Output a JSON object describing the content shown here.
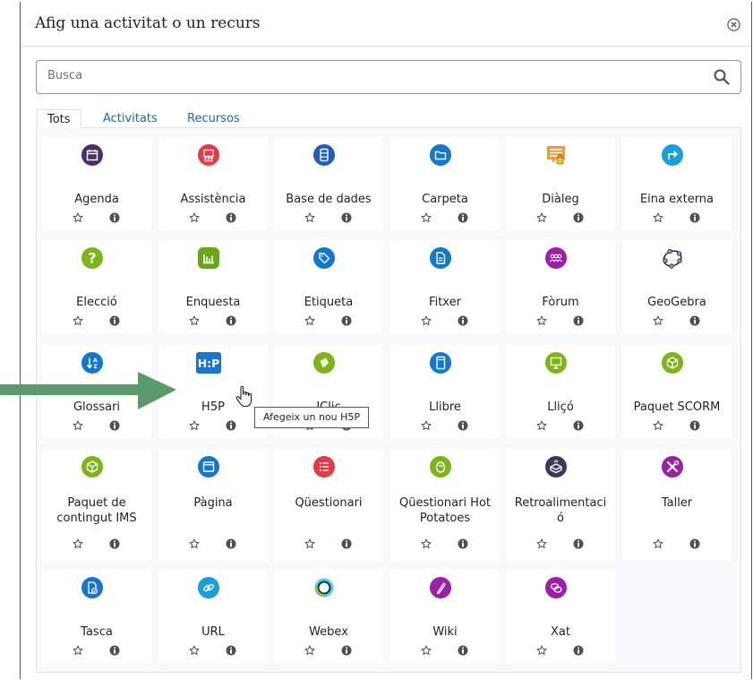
{
  "dialog": {
    "title": "Afig una activitat o un recurs",
    "search_placeholder": "Busca",
    "tabs": [
      {
        "label": "Tots"
      },
      {
        "label": "Activitats"
      },
      {
        "label": "Recursos"
      }
    ]
  },
  "modules": [
    {
      "label": "Agenda",
      "icon": "calendar-icon",
      "color": "#4b2e6f"
    },
    {
      "label": "Assistència",
      "icon": "attendance-icon",
      "color": "#e63946"
    },
    {
      "label": "Base de dades",
      "icon": "database-icon",
      "color": "#1f5fbf"
    },
    {
      "label": "Carpeta",
      "icon": "folder-icon",
      "color": "#1177d1"
    },
    {
      "label": "Diàleg",
      "icon": "dialogue-icon",
      "color": "#f09a3e"
    },
    {
      "label": "Eina externa",
      "icon": "external-tool-icon",
      "color": "#1a9ed9"
    },
    {
      "label": "Elecció",
      "icon": "choice-icon",
      "color": "#7cb518"
    },
    {
      "label": "Enquesta",
      "icon": "survey-icon",
      "color": "#6aa61a"
    },
    {
      "label": "Etiqueta",
      "icon": "label-icon",
      "color": "#1177d1"
    },
    {
      "label": "Fitxer",
      "icon": "file-icon",
      "color": "#1177d1"
    },
    {
      "label": "Fòrum",
      "icon": "forum-icon",
      "color": "#9b1fa8"
    },
    {
      "label": "GeoGebra",
      "icon": "geogebra-icon",
      "color": "#5b4fc9"
    },
    {
      "label": "Glossari",
      "icon": "glossary-icon",
      "color": "#1177d1"
    },
    {
      "label": "H5P",
      "icon": "h5p-icon",
      "color": "#1a73d1"
    },
    {
      "label": "JClic",
      "icon": "jclic-icon",
      "color": "#7cb518"
    },
    {
      "label": "Llibre",
      "icon": "book-icon",
      "color": "#1177d1"
    },
    {
      "label": "Lliçó",
      "icon": "lesson-icon",
      "color": "#7cb518"
    },
    {
      "label": "Paquet SCORM",
      "icon": "scorm-icon",
      "color": "#7cb518"
    },
    {
      "label": "Paquet de contingut IMS",
      "icon": "ims-package-icon",
      "color": "#7cb518"
    },
    {
      "label": "Pàgina",
      "icon": "page-icon",
      "color": "#1177d1"
    },
    {
      "label": "Qüestionari",
      "icon": "quiz-icon",
      "color": "#e63946"
    },
    {
      "label": "Qüestionari Hot Potatoes",
      "icon": "hotpotatoes-icon",
      "color": "#7cb518"
    },
    {
      "label": "Retroalimentació",
      "icon": "feedback-icon",
      "color": "#3a3a5c"
    },
    {
      "label": "Taller",
      "icon": "workshop-icon",
      "color": "#9b1fa8"
    },
    {
      "label": "Tasca",
      "icon": "assignment-icon",
      "color": "#1a73d1"
    },
    {
      "label": "URL",
      "icon": "url-icon",
      "color": "#1a9ed9"
    },
    {
      "label": "Webex",
      "icon": "webex-icon",
      "color": "#00a0d1"
    },
    {
      "label": "Wiki",
      "icon": "wiki-icon",
      "color": "#9b1fa8"
    },
    {
      "label": "Xat",
      "icon": "chat-icon",
      "color": "#9b1fa8"
    }
  ],
  "tooltip": "Afegeix un nou H5P",
  "annotation_arrow_color": "#5a9a6a"
}
